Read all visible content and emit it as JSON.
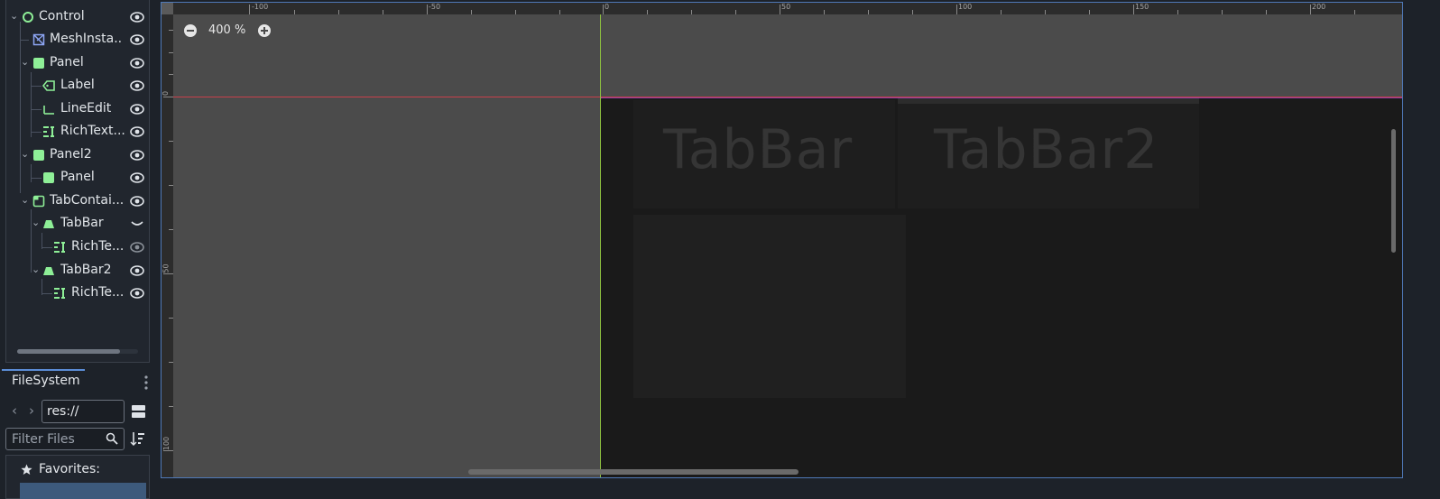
{
  "scene_tree": {
    "nodes": [
      {
        "label": "Control",
        "icon": "control-node-icon",
        "has_chevron": true
      },
      {
        "label": "MeshInsta...",
        "icon": "mesh-instance-icon",
        "has_chevron": false
      },
      {
        "label": "Panel",
        "icon": "panel-node-icon",
        "has_chevron": true
      },
      {
        "label": "Label",
        "icon": "label-node-icon",
        "has_chevron": false
      },
      {
        "label": "LineEdit",
        "icon": "line-edit-icon",
        "has_chevron": false
      },
      {
        "label": "RichText...",
        "icon": "rich-text-icon",
        "has_chevron": false
      },
      {
        "label": "Panel2",
        "icon": "panel-node-icon",
        "has_chevron": true
      },
      {
        "label": "Panel",
        "icon": "panel-node-icon",
        "has_chevron": false
      },
      {
        "label": "TabContai...",
        "icon": "tab-container-icon",
        "has_chevron": true
      },
      {
        "label": "TabBar",
        "icon": "tab-bar-icon",
        "has_chevron": true
      },
      {
        "label": "RichTe...",
        "icon": "rich-text-icon",
        "has_chevron": false
      },
      {
        "label": "TabBar2",
        "icon": "tab-bar-icon",
        "has_chevron": true
      },
      {
        "label": "RichTe...",
        "icon": "rich-text-icon",
        "has_chevron": false
      }
    ],
    "colors": {
      "node_green": "#8eef97",
      "mesh_blue": "#8da5f3",
      "eye": "#dfe3e8"
    }
  },
  "filesystem": {
    "tab_label": "FileSystem",
    "path_value": "res://",
    "filter_placeholder": "Filter Files",
    "favorites_label": "Favorites:"
  },
  "viewport": {
    "zoom_label": "400 %",
    "ruler_top_labels": [
      "-100",
      "-50",
      "0",
      "50",
      "100",
      "150",
      "200"
    ],
    "ruler_left_labels": [
      "0",
      "50",
      "100"
    ],
    "tab_labels": [
      "TabBar",
      "TabBar2"
    ],
    "colors": {
      "x_axis": "#c7404a",
      "y_axis": "#8bbd3f",
      "selection": "#4f79b8"
    }
  }
}
